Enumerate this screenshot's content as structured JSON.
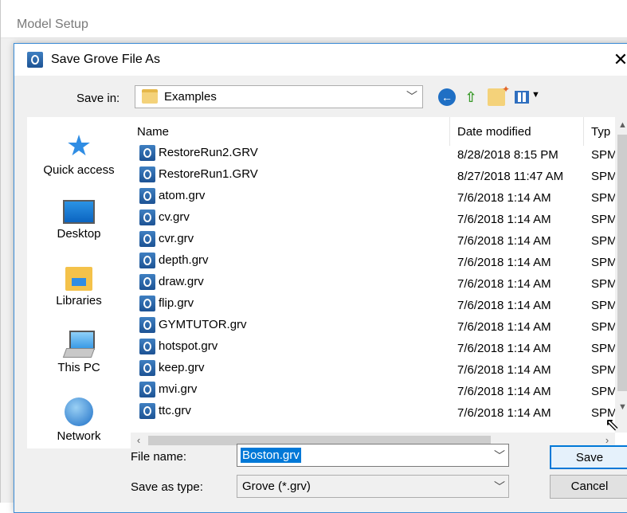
{
  "outer_window": {
    "title": "Model Setup"
  },
  "dialog": {
    "title": "Save Grove File As",
    "close_glyph": "✕"
  },
  "save_in": {
    "label": "Save in:",
    "value": "Examples"
  },
  "toolbar": {
    "back_icon": "back-arrow-icon",
    "up_icon": "up-folder-icon",
    "new_folder_icon": "new-folder-icon",
    "view_icon": "view-menu-icon"
  },
  "places": [
    {
      "label": "Quick access",
      "icon": "star-icon"
    },
    {
      "label": "Desktop",
      "icon": "desktop-icon"
    },
    {
      "label": "Libraries",
      "icon": "libraries-icon"
    },
    {
      "label": "This PC",
      "icon": "computer-icon"
    },
    {
      "label": "Network",
      "icon": "network-icon"
    }
  ],
  "columns": {
    "name": "Name",
    "date": "Date modified",
    "type": "Typ"
  },
  "files": [
    {
      "name": "RestoreRun2.GRV",
      "date": "8/28/2018 8:15 PM",
      "type": "SPM"
    },
    {
      "name": "RestoreRun1.GRV",
      "date": "8/27/2018 11:47 AM",
      "type": "SPM"
    },
    {
      "name": "atom.grv",
      "date": "7/6/2018 1:14 AM",
      "type": "SPM"
    },
    {
      "name": "cv.grv",
      "date": "7/6/2018 1:14 AM",
      "type": "SPM"
    },
    {
      "name": "cvr.grv",
      "date": "7/6/2018 1:14 AM",
      "type": "SPM"
    },
    {
      "name": "depth.grv",
      "date": "7/6/2018 1:14 AM",
      "type": "SPM"
    },
    {
      "name": "draw.grv",
      "date": "7/6/2018 1:14 AM",
      "type": "SPM"
    },
    {
      "name": "flip.grv",
      "date": "7/6/2018 1:14 AM",
      "type": "SPM"
    },
    {
      "name": "GYMTUTOR.grv",
      "date": "7/6/2018 1:14 AM",
      "type": "SPM"
    },
    {
      "name": "hotspot.grv",
      "date": "7/6/2018 1:14 AM",
      "type": "SPM"
    },
    {
      "name": "keep.grv",
      "date": "7/6/2018 1:14 AM",
      "type": "SPM"
    },
    {
      "name": "mvi.grv",
      "date": "7/6/2018 1:14 AM",
      "type": "SPM"
    },
    {
      "name": "ttc.grv",
      "date": "7/6/2018 1:14 AM",
      "type": "SPM"
    }
  ],
  "file_name": {
    "label": "File name:",
    "value": "Boston.grv"
  },
  "file_type": {
    "label": "Save as type:",
    "value": "Grove (*.grv)"
  },
  "buttons": {
    "save": "Save",
    "cancel": "Cancel"
  }
}
